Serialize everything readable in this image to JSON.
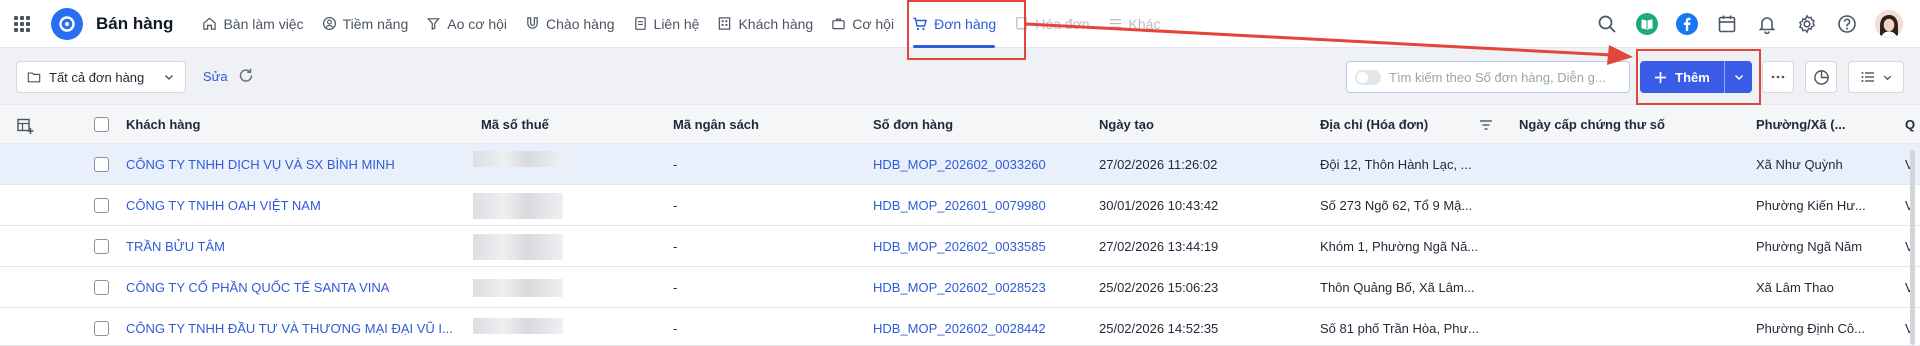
{
  "app": {
    "title": "Bán hàng"
  },
  "nav": {
    "items": [
      {
        "label": "Bàn làm việc",
        "icon": "home-icon",
        "state": "normal"
      },
      {
        "label": "Tiềm năng",
        "icon": "user-circle-icon",
        "state": "normal"
      },
      {
        "label": "Ao cơ hội",
        "icon": "funnel-icon",
        "state": "normal"
      },
      {
        "label": "Chào hàng",
        "icon": "magnet-icon",
        "state": "normal"
      },
      {
        "label": "Liên hệ",
        "icon": "contact-card-icon",
        "state": "normal"
      },
      {
        "label": "Khách hàng",
        "icon": "building-icon",
        "state": "normal"
      },
      {
        "label": "Cơ hội",
        "icon": "briefcase-icon",
        "state": "normal"
      },
      {
        "label": "Đơn hàng",
        "icon": "cart-icon",
        "state": "active"
      },
      {
        "label": "Hóa đơn",
        "icon": "receipt-icon",
        "state": "faded"
      },
      {
        "label": "Khác",
        "icon": "menu-lines-icon",
        "state": "faded"
      }
    ]
  },
  "topbar": {
    "icons": [
      "search-icon",
      "book-icon",
      "facebook-icon",
      "calendar-icon",
      "bell-icon",
      "gear-icon",
      "help-icon",
      "avatar"
    ],
    "colors": {
      "book": "#1faa7a",
      "facebook": "#1877f2"
    }
  },
  "toolbar": {
    "view_label": "Tất cả đơn hàng",
    "edit_label": "Sửa",
    "search_placeholder": "Tìm kiếm theo Số đơn hàng, Diễn g...",
    "add_label": "Thêm"
  },
  "table": {
    "columns": [
      "Khách hàng",
      "Mã số thuế",
      "Mã ngân sách",
      "Số đơn hàng",
      "Ngày tạo",
      "Địa chỉ (Hóa đơn)",
      "Ngày cấp chứng thư số",
      "Phường/Xã (...",
      "Q"
    ],
    "rows": [
      {
        "customer": "CÔNG TY TNHH DỊCH VỤ VÀ SX BÌNH MINH",
        "budget": "-",
        "order": "HDB_MOP_202602_0033260",
        "created": "27/02/2026 11:26:02",
        "address": "Đội 12, Thôn Hành Lạc, ...",
        "ward": "Xã Như Quỳnh",
        "cut": "V",
        "selected": true
      },
      {
        "customer": "CÔNG TY TNHH OAH VIỆT NAM",
        "budget": "-",
        "order": "HDB_MOP_202601_0079980",
        "created": "30/01/2026 10:43:42",
        "address": "Số 273 Ngõ 62, Tổ 9 Mậ...",
        "ward": "Phường Kiến Hư...",
        "cut": "V",
        "selected": false
      },
      {
        "customer": "TRẦN BỬU TÂM",
        "budget": "-",
        "order": "HDB_MOP_202602_0033585",
        "created": "27/02/2026 13:44:19",
        "address": "Khóm 1, Phường Ngã Nă...",
        "ward": "Phường Ngã Năm",
        "cut": "V",
        "selected": false
      },
      {
        "customer": "CÔNG TY CỔ PHẦN QUỐC TẾ SANTA VINA",
        "budget": "-",
        "order": "HDB_MOP_202602_0028523",
        "created": "25/02/2026 15:06:23",
        "address": "Thôn Quảng Bố, Xã Lâm...",
        "ward": "Xã Lâm Thao",
        "cut": "V",
        "selected": false
      },
      {
        "customer": "CÔNG TY TNHH ĐẦU TƯ VÀ THƯƠNG MẠI ĐẠI VŨ I...",
        "budget": "-",
        "order": "HDB_MOP_202602_0028442",
        "created": "25/02/2026 14:52:35",
        "address": "Số 81 phố Trần Hòa, Phư...",
        "ward": "Phường Định Cô...",
        "cut": "V",
        "selected": false
      }
    ]
  },
  "annotation": {
    "color": "#e2453a"
  }
}
